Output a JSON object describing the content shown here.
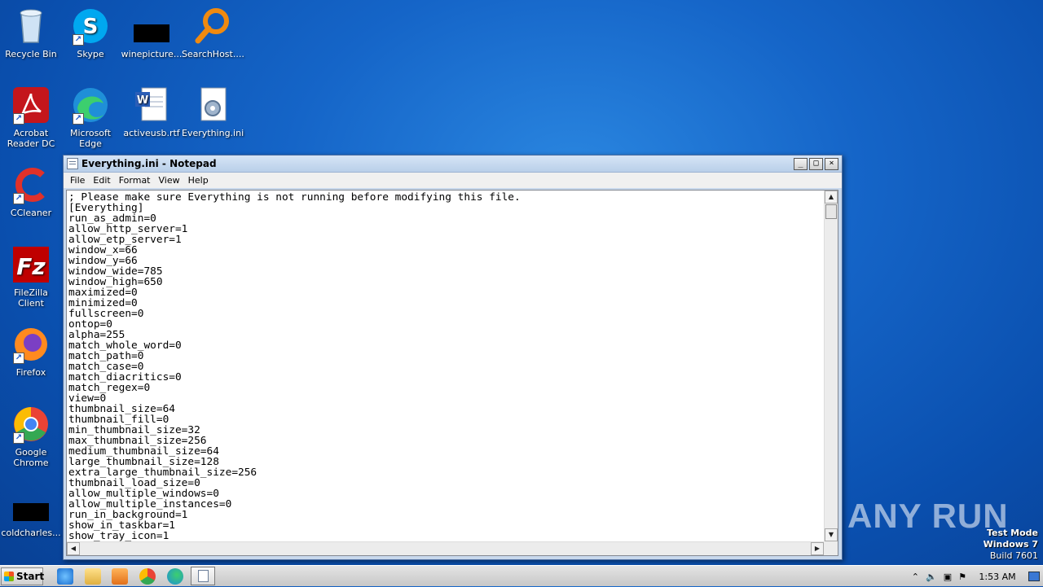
{
  "desktop": {
    "icons": [
      {
        "label": "Recycle Bin"
      },
      {
        "label": "Skype"
      },
      {
        "label": "winepicture..."
      },
      {
        "label": "SearchHost...."
      },
      {
        "label": "Acrobat Reader DC"
      },
      {
        "label": "Microsoft Edge"
      },
      {
        "label": "activeusb.rtf"
      },
      {
        "label": "Everything.ini"
      },
      {
        "label": "CCleaner"
      },
      {
        "label": "FileZilla Client"
      },
      {
        "label": "Firefox"
      },
      {
        "label": "Google Chrome"
      },
      {
        "label": "coldcharles..."
      }
    ]
  },
  "notepad": {
    "title": "Everything.ini - Notepad",
    "menu": [
      "File",
      "Edit",
      "Format",
      "View",
      "Help"
    ],
    "lines": [
      "; Please make sure Everything is not running before modifying this file.",
      "[Everything]",
      "run_as_admin=0",
      "allow_http_server=1",
      "allow_etp_server=1",
      "window_x=66",
      "window_y=66",
      "window_wide=785",
      "window_high=650",
      "maximized=0",
      "minimized=0",
      "fullscreen=0",
      "ontop=0",
      "alpha=255",
      "match_whole_word=0",
      "match_path=0",
      "match_case=0",
      "match_diacritics=0",
      "match_regex=0",
      "view=0",
      "thumbnail_size=64",
      "thumbnail_fill=0",
      "min_thumbnail_size=32",
      "max_thumbnail_size=256",
      "medium_thumbnail_size=64",
      "large_thumbnail_size=128",
      "extra_large_thumbnail_size=256",
      "thumbnail_load_size=0",
      "allow_multiple_windows=0",
      "allow_multiple_instances=0",
      "run_in_background=1",
      "show_in_taskbar=1",
      "show_tray_icon=1"
    ]
  },
  "watermark": {
    "text": "ANY RUN"
  },
  "testmode": {
    "line1": "Test Mode",
    "line2": "Windows 7",
    "line3": "Build 7601"
  },
  "taskbar": {
    "start_label": "Start",
    "clock": "1:53 AM"
  }
}
